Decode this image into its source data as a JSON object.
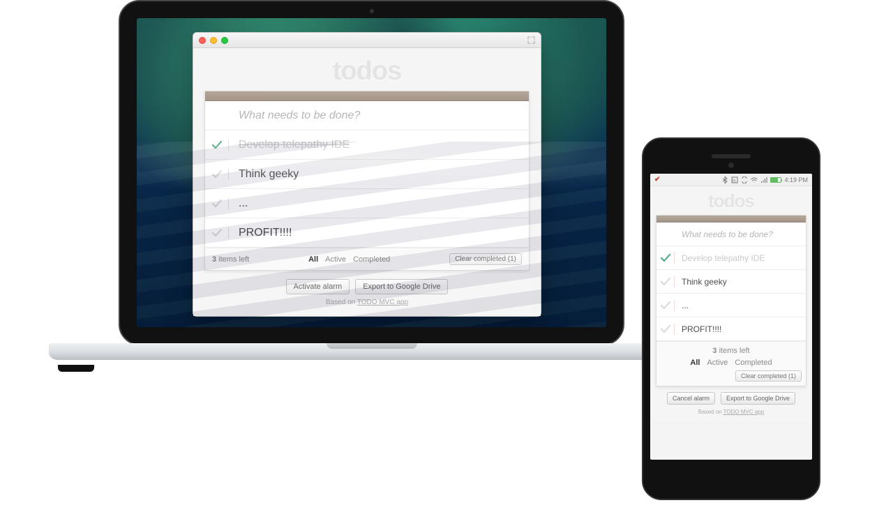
{
  "app": {
    "title": "todos",
    "input_placeholder": "What needs to be done?",
    "credit_prefix": "Based on ",
    "credit_link": "TODO MVC app"
  },
  "items": [
    {
      "text": "Develop telepathy IDE",
      "completed": true
    },
    {
      "text": "Think geeky",
      "completed": false
    },
    {
      "text": "...",
      "completed": false
    },
    {
      "text": "PROFIT!!!!",
      "completed": false
    }
  ],
  "footer": {
    "count": "3",
    "count_suffix": " items left",
    "filters": {
      "all": "All",
      "active": "Active",
      "completed": "Completed"
    },
    "clear_label": "Clear completed (1)"
  },
  "desktop_actions": {
    "alarm": "Activate alarm",
    "export": "Export to Google Drive"
  },
  "phone_actions": {
    "alarm": "Cancel alarm",
    "export": "Export to Google Drive"
  },
  "phone_statusbar": {
    "time": "4:19 PM"
  }
}
